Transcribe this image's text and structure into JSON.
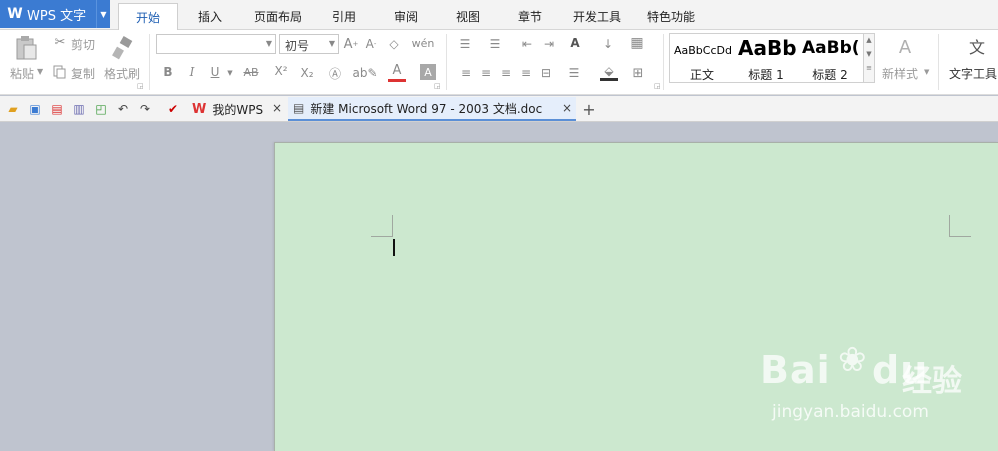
{
  "app": {
    "title": "WPS 文字",
    "logo_glyph": "W"
  },
  "ribbon_tabs": [
    {
      "label": "开始",
      "active": true
    },
    {
      "label": "插入"
    },
    {
      "label": "页面布局"
    },
    {
      "label": "引用"
    },
    {
      "label": "审阅"
    },
    {
      "label": "视图"
    },
    {
      "label": "章节"
    },
    {
      "label": "开发工具"
    },
    {
      "label": "特色功能"
    }
  ],
  "clipboard": {
    "paste": "粘贴",
    "cut": "剪切",
    "copy": "复制",
    "format_painter": "格式刷"
  },
  "font": {
    "name_value": "",
    "size_value": "初号"
  },
  "styles": [
    {
      "sample": "AaBbCcDd",
      "name": "正文"
    },
    {
      "sample": "AaBb",
      "name": "标题 1"
    },
    {
      "sample": "AaBb(",
      "name": "标题 2"
    }
  ],
  "new_style": "新样式",
  "text_tools": "文字工具",
  "doc_tabs": [
    {
      "label": "我的WPS",
      "active": false
    },
    {
      "label": "新建 Microsoft Word 97 - 2003 文档.doc",
      "active": true
    }
  ],
  "watermark": {
    "brand": "Bai",
    "brand2": "经验",
    "url": "jingyan.baidu.com"
  },
  "colors": {
    "accent": "#3b7bd2",
    "page": "#cce8cf",
    "workspace": "#bfc4cf"
  }
}
